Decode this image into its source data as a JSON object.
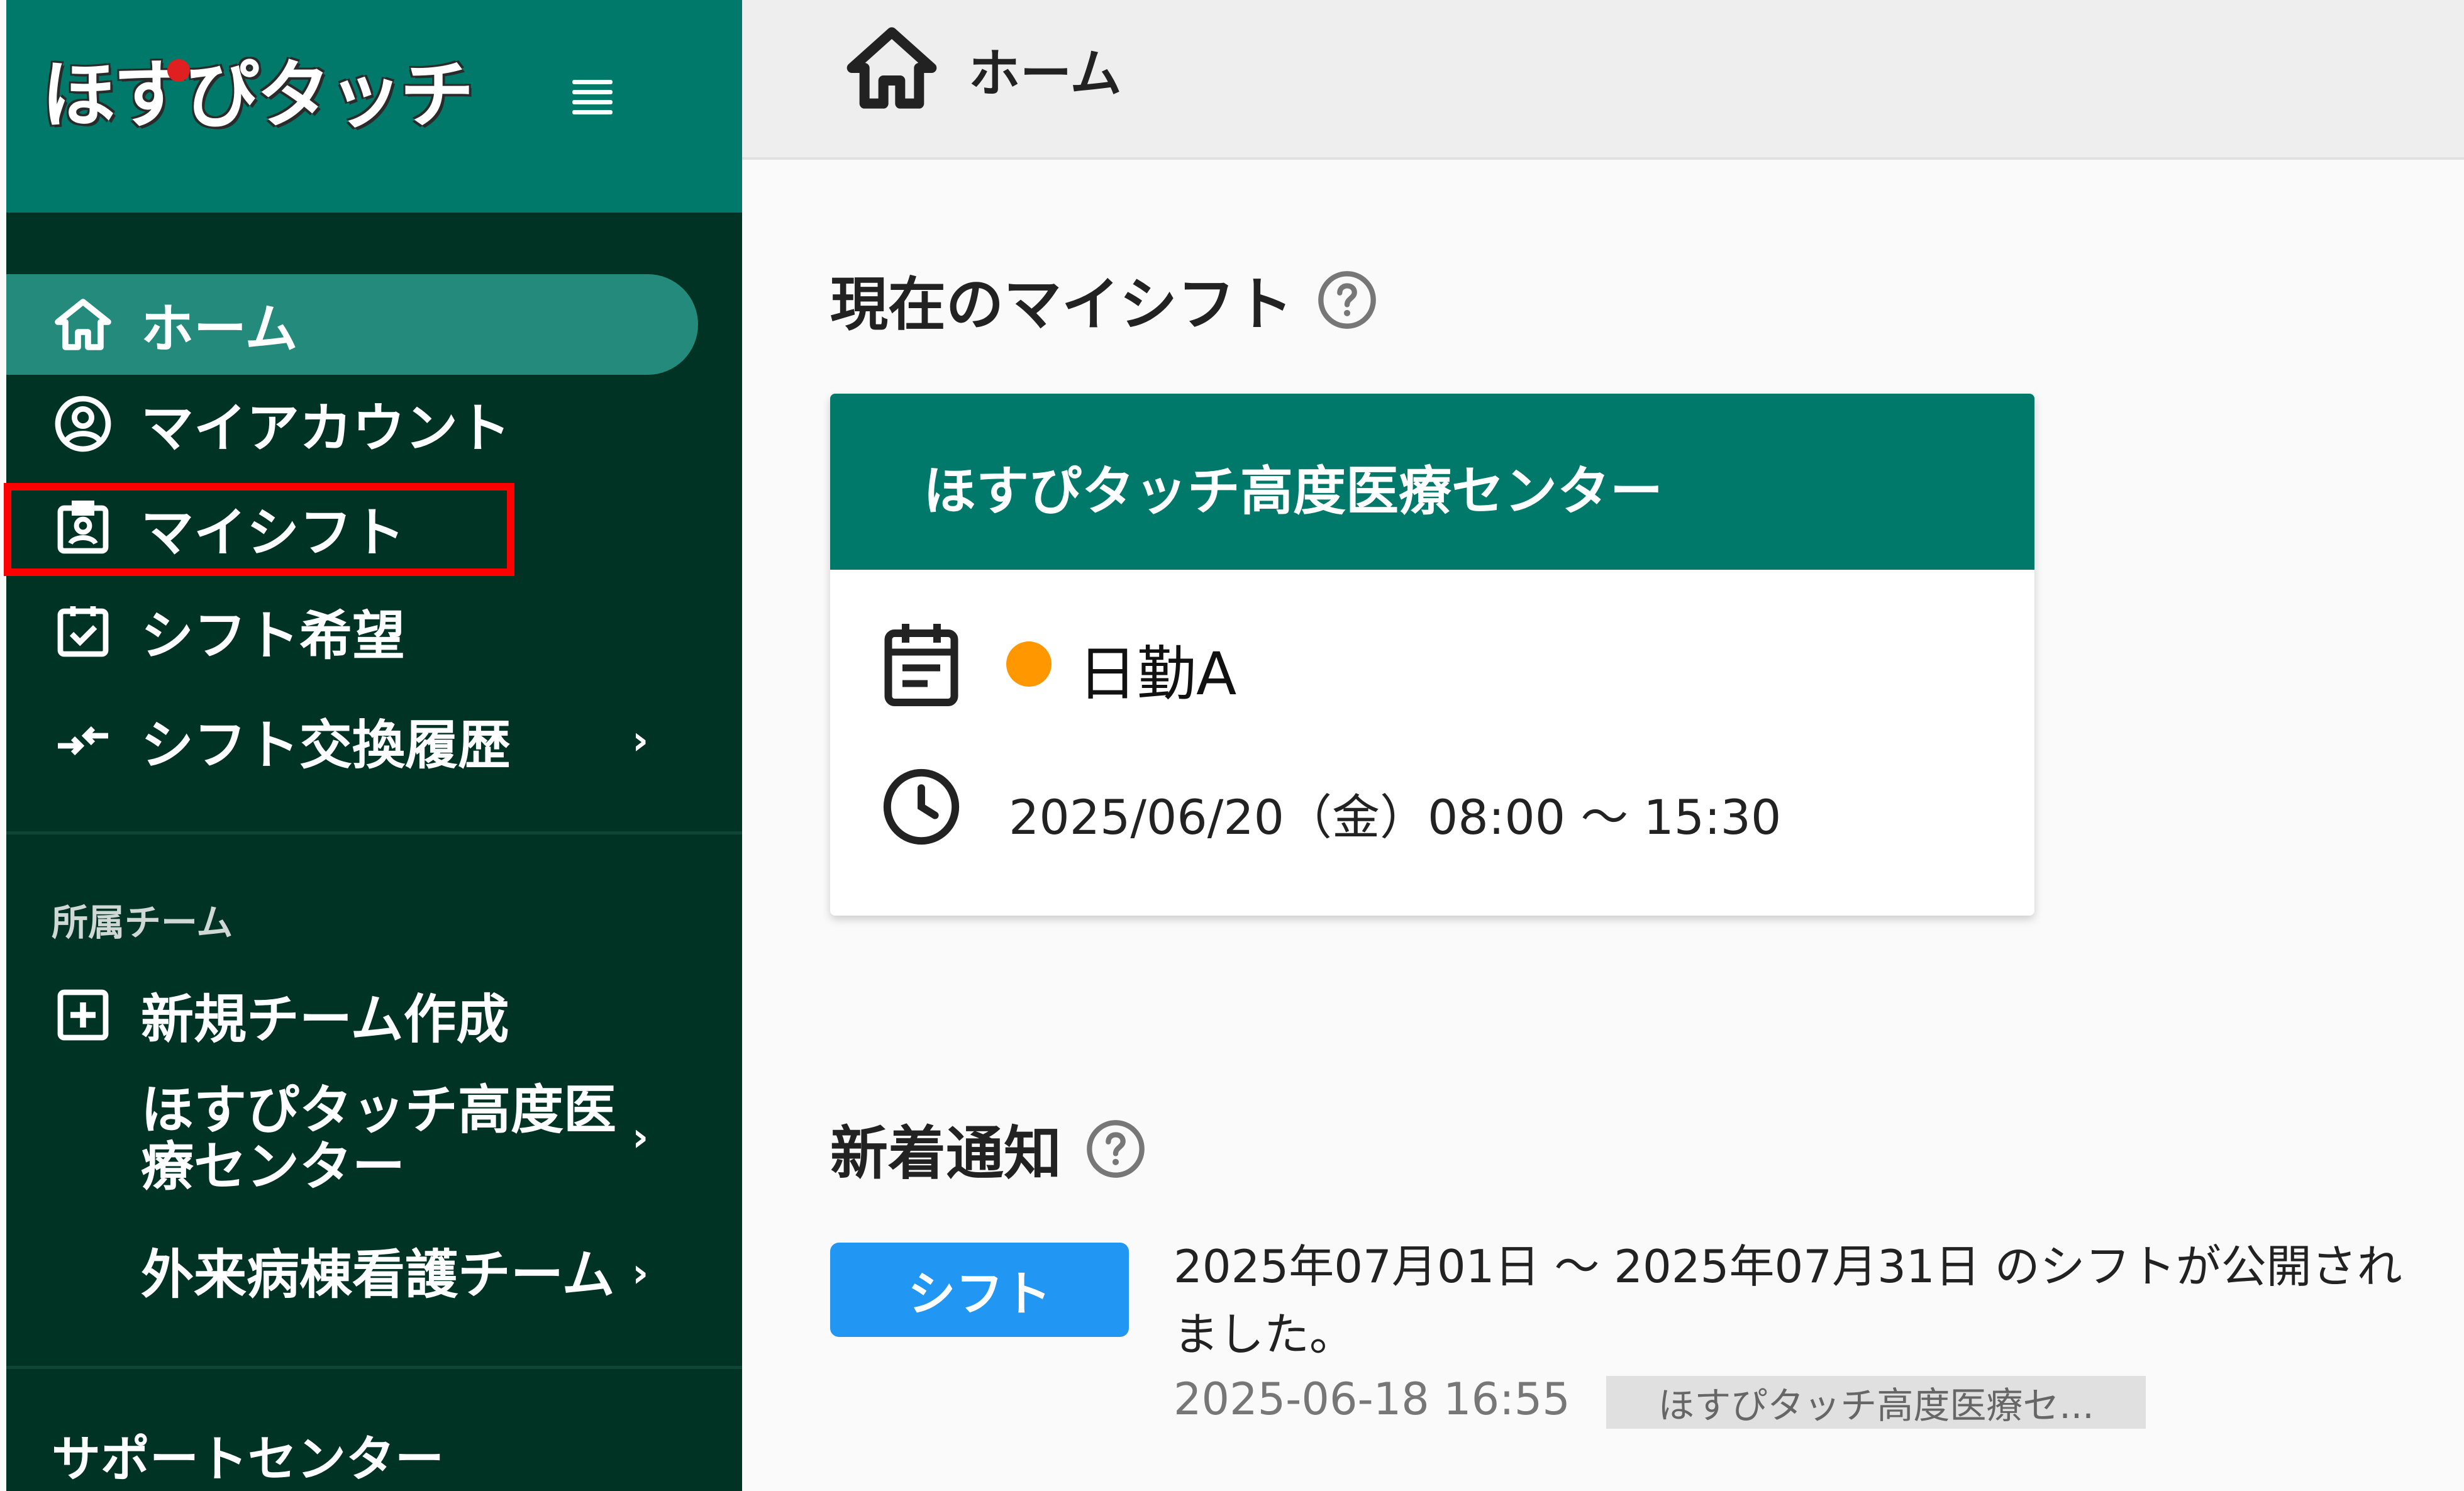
{
  "app": {
    "logo_text": "ほすぴタッチ"
  },
  "header": {
    "title": "ホーム"
  },
  "sidebar": {
    "items": [
      {
        "label": "ホーム",
        "icon": "home-icon",
        "active": true
      },
      {
        "label": "マイアカウント",
        "icon": "account-circle-icon"
      },
      {
        "label": "マイシフト",
        "icon": "badge-icon"
      },
      {
        "label": "シフト希望",
        "icon": "calendar-check-icon"
      },
      {
        "label": "シフト交換履歴",
        "icon": "swap-icon",
        "chevron": "›"
      }
    ],
    "team_section_label": "所属チーム",
    "team_items": [
      {
        "label": "新規チーム作成",
        "icon": "add-box-icon"
      },
      {
        "label": "ほすぴタッチ高度医療センター",
        "line1": "ほすぴタッチ高度医",
        "line2": "療センター",
        "chevron": "›"
      },
      {
        "label": "外来病棟看護チーム",
        "chevron": "›"
      }
    ],
    "support_label": "サポートセンター"
  },
  "current_shift": {
    "section_title": "現在のマイシフト",
    "facility": "ほすぴタッチ高度医療センター",
    "shift_name": "日勤A",
    "shift_color": "#ff9800",
    "time_text": "2025/06/20（金）08:00 〜 15:30"
  },
  "notifications": {
    "section_title": "新着通知",
    "items": [
      {
        "tag": "シフト",
        "message": "2025年07月01日 〜 2025年07月31日 のシフトが公開されました。",
        "datetime": "2025-06-18 16:55",
        "team": "ほすぴタッチ高度医療セ..."
      }
    ]
  },
  "colors": {
    "sidebar_bg": "#003323",
    "brand": "#00786a",
    "active_item": "#238a7c",
    "tag_blue": "#2196f3",
    "highlight": "#ff0000"
  }
}
